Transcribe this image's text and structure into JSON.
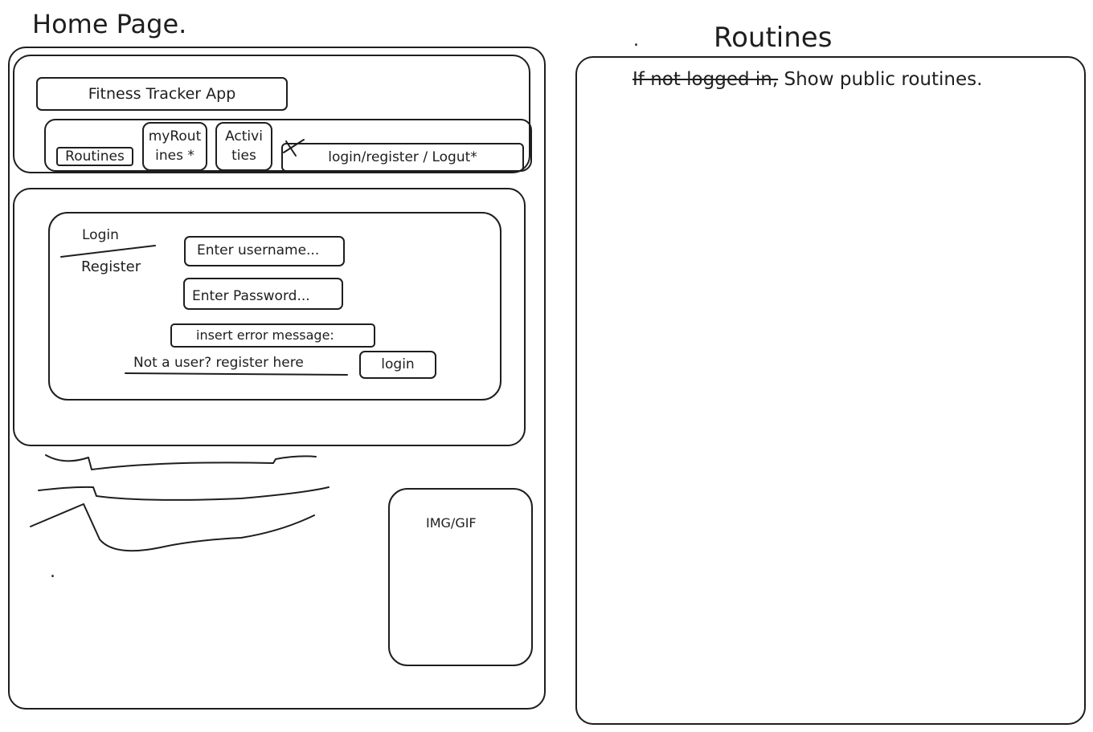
{
  "titles": {
    "home": "Home Page.",
    "routines": "Routines",
    "routines_dot": "."
  },
  "header": {
    "app_title": "Fitness Tracker App",
    "nav": {
      "routines": "Routines",
      "my_routines_line1": "myRout",
      "my_routines_line2": "ines *",
      "activities_line1": "Activi",
      "activities_line2": "ties",
      "auth": "login/register / Logut*"
    }
  },
  "login_form": {
    "tab_login": "Login",
    "tab_register": "Register",
    "username_placeholder": "Enter username...",
    "password_placeholder": "Enter Password...",
    "error_message": "insert error message:",
    "register_link": "Not a user? register here",
    "login_button": "login"
  },
  "media": {
    "placeholder": "IMG/GIF",
    "dot": "."
  },
  "routines_panel": {
    "note_struck": "If not logged in,",
    "note_text": " Show public routines."
  }
}
